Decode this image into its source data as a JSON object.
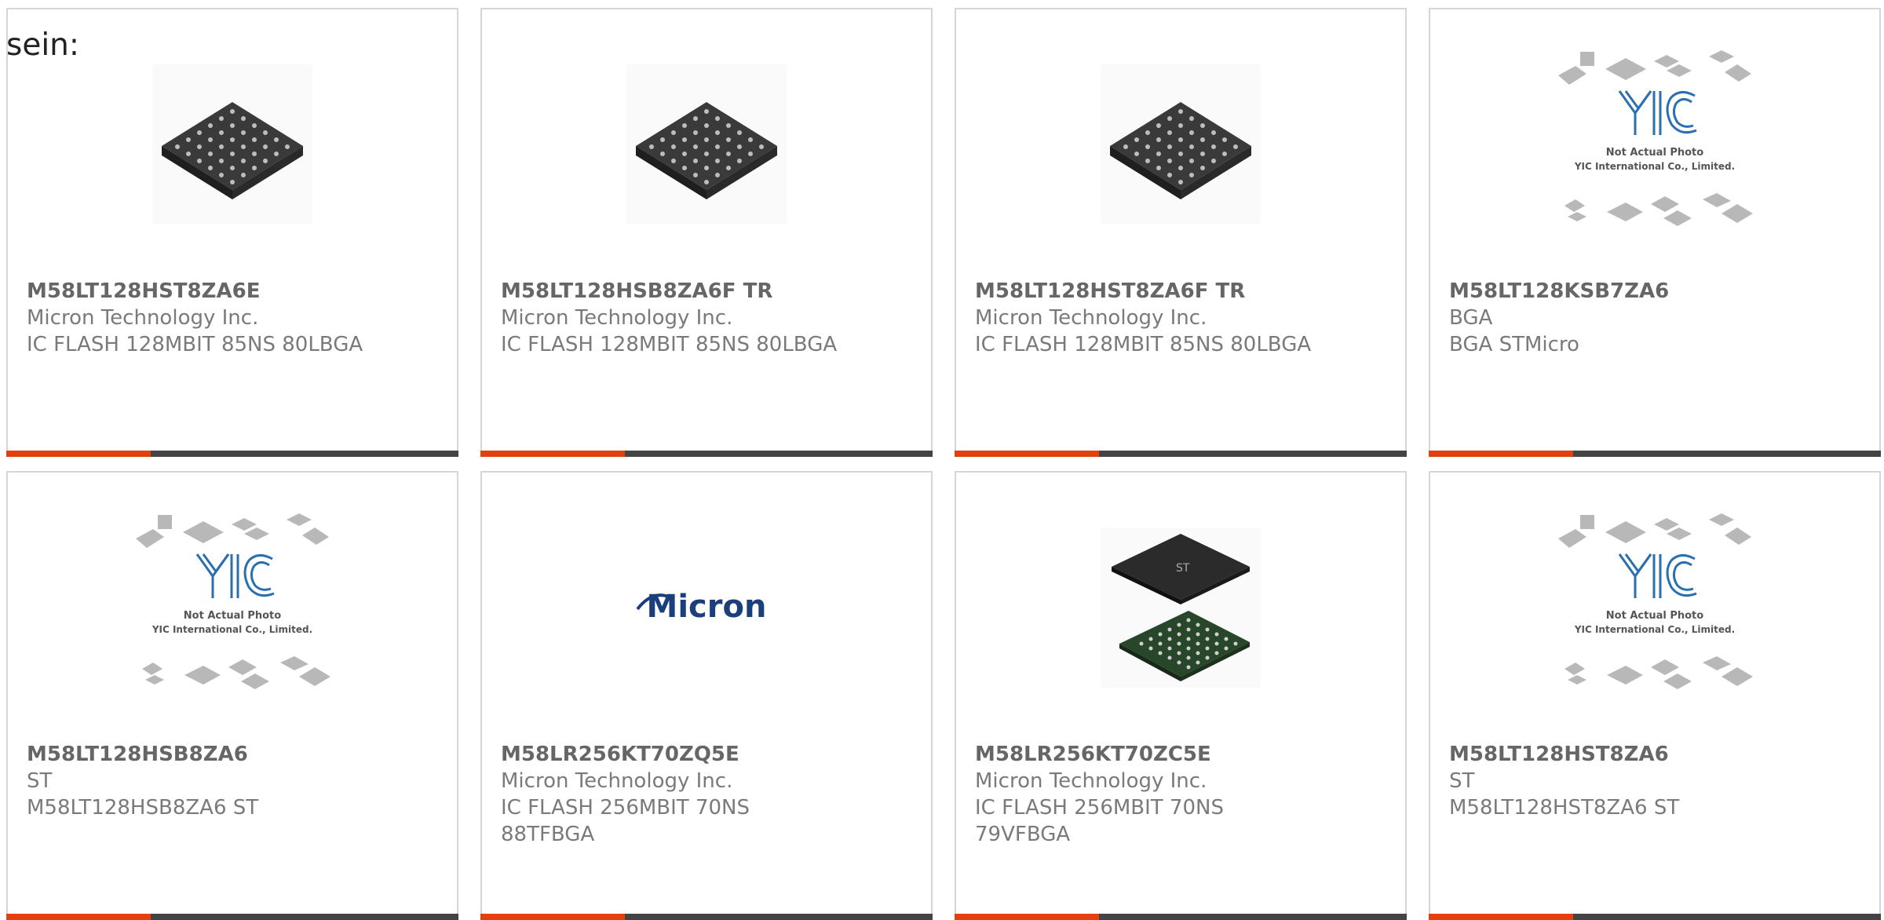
{
  "intro_text": "sein:",
  "products": [
    {
      "part": "M58LT128HST8ZA6E",
      "line1": "Micron Technology Inc.",
      "line2": "IC FLASH 128MBIT 85NS 80LBGA",
      "image": "bga-chip"
    },
    {
      "part": "M58LT128HSB8ZA6F TR",
      "line1": "Micron Technology Inc.",
      "line2": "IC FLASH 128MBIT 85NS 80LBGA",
      "image": "bga-chip"
    },
    {
      "part": "M58LT128HST8ZA6F TR",
      "line1": "Micron Technology Inc.",
      "line2": "IC FLASH 128MBIT 85NS 80LBGA",
      "image": "bga-chip"
    },
    {
      "part": "M58LT128KSB7ZA6",
      "line1": "BGA",
      "line2": "BGA STMicro",
      "image": "yic-placeholder"
    },
    {
      "part": "M58LT128HSB8ZA6",
      "line1": "ST",
      "line2": "M58LT128HSB8ZA6 ST",
      "image": "yic-placeholder"
    },
    {
      "part": "M58LR256KT70ZQ5E",
      "line1": "Micron Technology Inc.",
      "line2": "IC FLASH 256MBIT 70NS",
      "line3": "88TFBGA",
      "image": "micron-logo"
    },
    {
      "part": "M58LR256KT70ZC5E",
      "line1": "Micron Technology Inc.",
      "line2": "IC FLASH 256MBIT 70NS",
      "line3": "79VFBGA",
      "image": "bga-chip-pair"
    },
    {
      "part": "M58LT128HST8ZA6",
      "line1": "ST",
      "line2": "M58LT128HST8ZA6 ST",
      "image": "yic-placeholder"
    }
  ],
  "placeholder": {
    "caption1": "Not Actual Photo",
    "caption2": "YIC International Co., Limited.",
    "logo_text": "YIC"
  },
  "micron_logo_text": "Micron",
  "colors": {
    "accent": "#e2410f",
    "bar": "#444444",
    "border": "#d6d6d6",
    "yic_blue": "#2a6fb0"
  }
}
